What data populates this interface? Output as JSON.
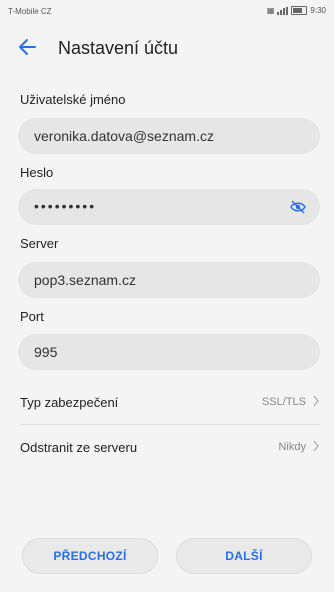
{
  "status": {
    "carrier": "T-Mobile CZ",
    "time": "9:30"
  },
  "header": {
    "title": "Nastavení účtu",
    "back_icon": "arrow-left-icon"
  },
  "form": {
    "username_label": "Uživatelské jméno",
    "username_value": "veronika.datova@seznam.cz",
    "password_label": "Heslo",
    "password_value": "•••••••••",
    "server_label": "Server",
    "server_value": "pop3.seznam.cz",
    "port_label": "Port",
    "port_value": "995"
  },
  "settings": {
    "security_label": "Typ zabezpečení",
    "security_value": "SSL/TLS",
    "delete_label": "Odstranit ze serveru",
    "delete_value": "Nikdy"
  },
  "buttons": {
    "previous": "PŘEDCHOZÍ",
    "next": "DALŠÍ"
  },
  "colors": {
    "accent": "#2a6ef0",
    "field_bg": "#e6e6e6",
    "background": "#f4f4f4"
  }
}
